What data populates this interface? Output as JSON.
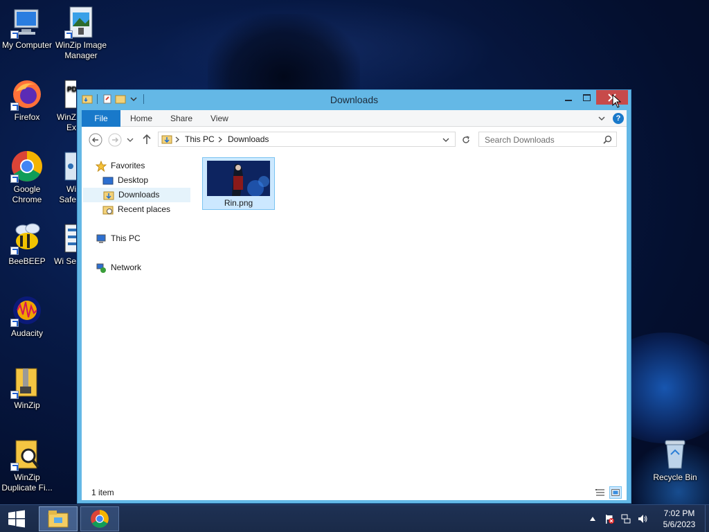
{
  "desktop": {
    "icons": [
      {
        "label": "My Computer"
      },
      {
        "label": "WinZip Image Manager"
      },
      {
        "label": "Firefox"
      },
      {
        "label": "WinZ Ex"
      },
      {
        "label": "Google Chrome"
      },
      {
        "label": "Wi Safe"
      },
      {
        "label": "BeeBEEP"
      },
      {
        "label": "Wi Se"
      },
      {
        "label": "Audacity"
      },
      {
        "label": "WinZip"
      },
      {
        "label": "WinZip Duplicate Fi..."
      },
      {
        "label": "Recycle Bin"
      }
    ]
  },
  "window": {
    "title": "Downloads",
    "ribbon_tabs": [
      "File",
      "Home",
      "Share",
      "View"
    ],
    "address": {
      "segments": [
        "This PC",
        "Downloads"
      ]
    },
    "search": {
      "placeholder": "Search Downloads"
    },
    "nav_pane": {
      "favorites": "Favorites",
      "items": [
        "Desktop",
        "Downloads",
        "Recent places"
      ],
      "this_pc": "This PC",
      "network": "Network",
      "selected": "Downloads"
    },
    "files": [
      {
        "name": "Rin.png"
      }
    ],
    "status": {
      "item_count": "1 item"
    }
  },
  "taskbar": {
    "clock": {
      "time": "7:02 PM",
      "date": "5/6/2023"
    }
  },
  "colors": {
    "accent": "#1979ca",
    "window_frame": "#64b8e6",
    "close_button": "#c74a4a",
    "selection": "#cce8ff"
  }
}
